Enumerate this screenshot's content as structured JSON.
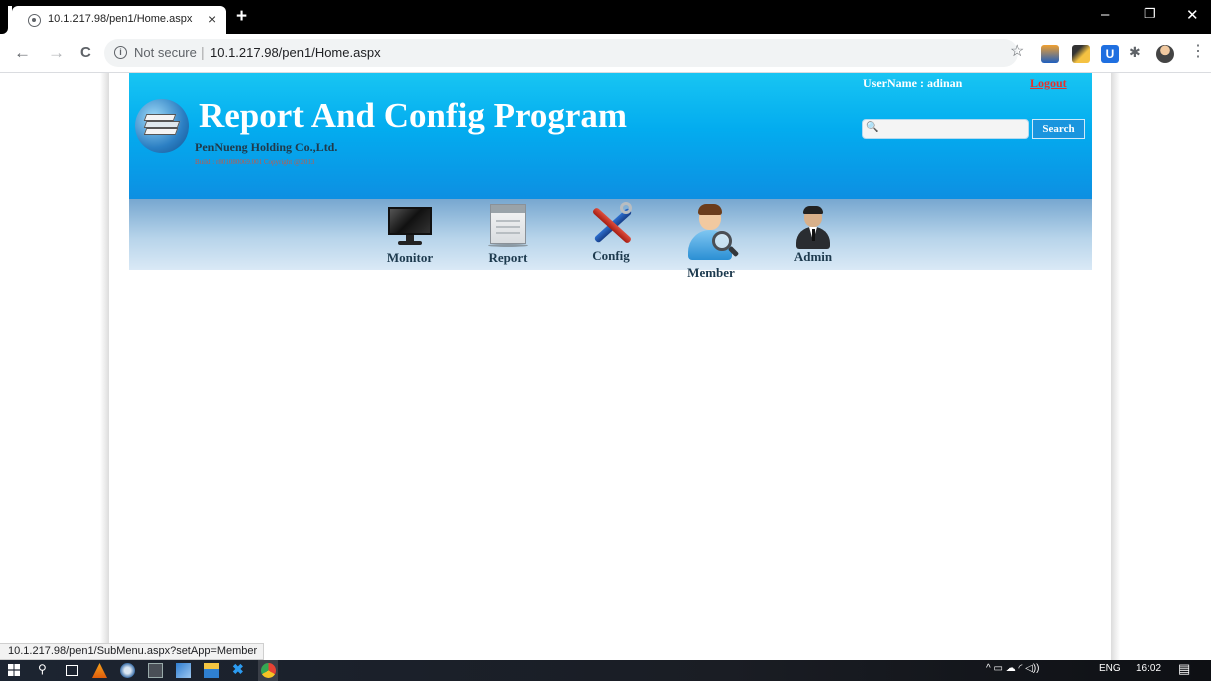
{
  "browser": {
    "tab_title": "10.1.217.98/pen1/Home.aspx",
    "tab_close": "×",
    "new_tab": "+",
    "security_label": "Not secure",
    "separator": "|",
    "url": "10.1.217.98/pen1/Home.aspx",
    "status_url": "10.1.217.98/pen1/SubMenu.aspx?setApp=Member",
    "window_controls": {
      "minimize": "–",
      "restore": "❐",
      "close": "✕"
    },
    "nav": {
      "back": "←",
      "forward": "→",
      "reload": "C"
    },
    "bookmark_star": "☆",
    "menu": "⋮",
    "extension_icons": [
      "redir-extension-icon",
      "dropper-extension-icon",
      "u-extension-icon",
      "puzzle-extension-icon",
      "profile-avatar-icon"
    ]
  },
  "header": {
    "title": "Report And Config Program",
    "company": "PenNueng Holding Co.,Ltd.",
    "build": "Build : r801080069.001 Copyright @2013",
    "username": "UserName : adinan",
    "logout": "Logout",
    "search_button": "Search",
    "search_placeholder": ""
  },
  "menu": {
    "items": [
      {
        "label": "Monitor",
        "icon": "monitor-icon"
      },
      {
        "label": "Report",
        "icon": "report-document-icon"
      },
      {
        "label": "Config",
        "icon": "config-tools-icon"
      },
      {
        "label": "Member",
        "icon": "member-search-icon"
      },
      {
        "label": "Admin",
        "icon": "admin-person-icon"
      }
    ]
  },
  "taskbar": {
    "language": "ENG",
    "time": "16:02",
    "tray_symbols": "^ ▭ ☁ ◜ ◁))",
    "notification": "▤"
  },
  "colors": {
    "header_top": "#18c5f3",
    "header_bottom": "#0d8fe2",
    "menubar_top": "#77a7d0",
    "menubar_bottom": "#dae9f6",
    "logout": "#e8312b"
  }
}
